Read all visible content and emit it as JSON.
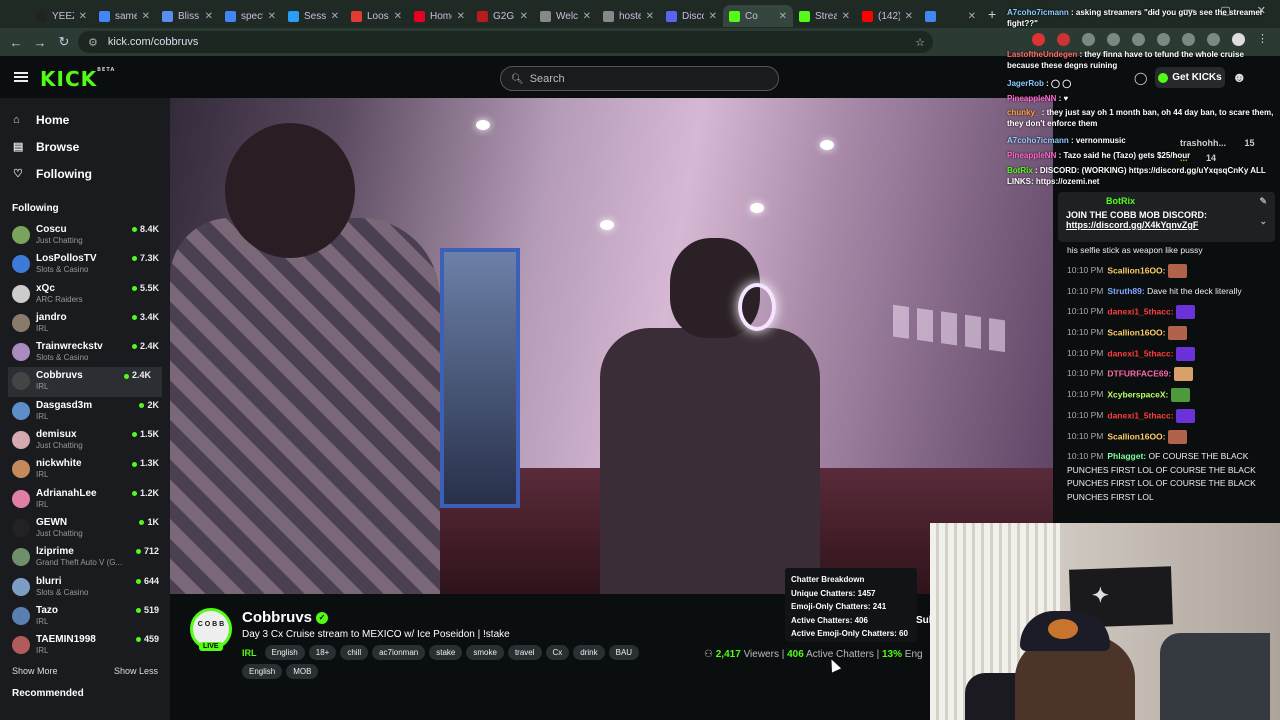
{
  "browser": {
    "tabs": [
      {
        "label": "YEEZY",
        "color": "#222222"
      },
      {
        "label": "same",
        "color": "#4285f4"
      },
      {
        "label": "Bliss",
        "color": "#5b8def"
      },
      {
        "label": "specti",
        "color": "#4285f4"
      },
      {
        "label": "Sessio",
        "color": "#2a9df4"
      },
      {
        "label": "Loose",
        "color": "#e03c31"
      },
      {
        "label": "Home",
        "color": "#e60023"
      },
      {
        "label": "G2G",
        "color": "#b71c1c"
      },
      {
        "label": "Welco",
        "color": "#888888"
      },
      {
        "label": "hostea",
        "color": "#888888"
      },
      {
        "label": "Disco",
        "color": "#5865f2"
      },
      {
        "label": "Co",
        "color": "#53fc18"
      },
      {
        "label": "Strean",
        "color": "#53fc18"
      },
      {
        "label": "(142)",
        "color": "#ff0000"
      },
      {
        "label": "",
        "color": "#4285f4"
      }
    ],
    "url": "kick.com/cobbruvs"
  },
  "header": {
    "logo": "KICK",
    "logo_badge": "BETA",
    "search_placeholder": "Search",
    "get_kicks": "Get KICKs"
  },
  "sidebar": {
    "nav": [
      {
        "label": "Home",
        "icon": "home-icon",
        "glyph": "⌂"
      },
      {
        "label": "Browse",
        "icon": "browse-icon",
        "glyph": "▤"
      },
      {
        "label": "Following",
        "icon": "heart-icon",
        "glyph": "♡"
      }
    ],
    "following_heading": "Following",
    "channels": [
      {
        "name": "Coscu",
        "category": "Just Chatting",
        "viewers": "8.4K",
        "color": "#7aa35b"
      },
      {
        "name": "LosPollosTV",
        "category": "Slots & Casino",
        "viewers": "7.3K",
        "color": "#3d7bd8"
      },
      {
        "name": "xQc",
        "category": "ARC Raiders",
        "viewers": "5.5K",
        "color": "#cccccc"
      },
      {
        "name": "jandro",
        "category": "IRL",
        "viewers": "3.4K",
        "color": "#8a7a6c"
      },
      {
        "name": "Trainwreckstv",
        "category": "Slots & Casino",
        "viewers": "2.4K",
        "color": "#a88cc0"
      },
      {
        "name": "Cobbruvs",
        "category": "IRL",
        "viewers": "2.4K",
        "color": "#444444"
      },
      {
        "name": "Dasgasd3m",
        "category": "IRL",
        "viewers": "2K",
        "color": "#5d8ec7"
      },
      {
        "name": "demisux",
        "category": "Just Chatting",
        "viewers": "1.5K",
        "color": "#d6a8b0"
      },
      {
        "name": "nickwhite",
        "category": "IRL",
        "viewers": "1.3K",
        "color": "#c48a5c"
      },
      {
        "name": "AdrianahLee",
        "category": "IRL",
        "viewers": "1.2K",
        "color": "#e07fa6"
      },
      {
        "name": "GEWN",
        "category": "Just Chatting",
        "viewers": "1K",
        "color": "#222222"
      },
      {
        "name": "lziprime",
        "category": "Grand Theft Auto V (G...",
        "viewers": "712",
        "color": "#6f8f6a"
      },
      {
        "name": "blurri",
        "category": "Slots & Casino",
        "viewers": "644",
        "color": "#7d9dc4"
      },
      {
        "name": "Tazo",
        "category": "IRL",
        "viewers": "519",
        "color": "#5a7fb0"
      },
      {
        "name": "TAEMIN1998",
        "category": "IRL",
        "viewers": "459",
        "color": "#b35a5a"
      }
    ],
    "show_more": "Show More",
    "show_less": "Show Less",
    "recommended": "Recommended"
  },
  "stream": {
    "avatar_text": "C O B B",
    "live": "LIVE",
    "name": "Cobbruvs",
    "verified_glyph": "✓",
    "title": "Day 3 Cx Cruise stream to MEXICO w/ Ice Poseidon | !stake",
    "category": "IRL",
    "tags": [
      "English",
      "18+",
      "chill",
      "ac7ionman",
      "stake",
      "smoke",
      "travel",
      "Cx",
      "drink",
      "BAU"
    ],
    "tags2": [
      "English",
      "MOB"
    ],
    "viewers": "2,417",
    "viewers_label": "Viewers",
    "active": "406",
    "active_label": "Active Chatters",
    "engaged": "13%",
    "engaged_label": "Eng",
    "sub_label": "Sub"
  },
  "tooltip": {
    "title": "Chatter Breakdown",
    "unique": "Unique Chatters: 1457",
    "emoji_only": "Emoji-Only Chatters: 241",
    "active": "Active Chatters: 406",
    "active_emoji": "Active Emoji-Only Chatters: 60"
  },
  "overlay_chat": [
    {
      "user": "A7coho7icmann",
      "text": " : asking streamers \"did you guys see the streamer fight??\"",
      "color": "#8ecbff"
    },
    {
      "user": "LastoftheUndegen",
      "text": " : they finna have to tefund the whole cruise because these degns ruining",
      "color": "#ff6b6b"
    },
    {
      "user": "JagerRob",
      "text": " : ◯ ◯",
      "color": "#8ecbff"
    },
    {
      "user": "PineappleNN",
      "text": " : ♥",
      "color": "#ff66cc"
    },
    {
      "user": "chunky_",
      "text": " : they just say oh 1 month ban, oh 44 day ban, to scare them, they don't enforce them",
      "color": "#ff9f40"
    },
    {
      "user": "A7coho7icmann",
      "text": " : vernonmusic",
      "color": "#8ecbff"
    },
    {
      "user": "PineappleNN",
      "text": " : Tazo said he (Tazo) gets $25/hour",
      "color": "#ff66cc"
    },
    {
      "user": "BotRix",
      "text": " : DISCORD: (WORKING) https://discord.gg/uYxqsqCnKy ALL LINKS: https://ozemi.net",
      "color": "#53fc18"
    }
  ],
  "overlay_side": [
    {
      "name": "trashohh...",
      "count": "15"
    },
    {
      "name": "...",
      "count": "14"
    }
  ],
  "pinned": {
    "author": "BotRix",
    "text": "JOIN THE COBB MOB DISCORD:",
    "link": "https://discord.gg/X4kYqnvZgF"
  },
  "chat": [
    {
      "time": "",
      "user": "",
      "text": "his selfie stick as weapon like pussy",
      "color": "#ffffff",
      "emote": ""
    },
    {
      "time": "10:10 PM",
      "user": "Scallion16OO:",
      "text": "",
      "color": "#ffcc66",
      "emote": "#b0634a"
    },
    {
      "time": "10:10 PM",
      "user": "Struth89:",
      "text": "Dave hit the deck literally",
      "color": "#7fa8ff",
      "emote": ""
    },
    {
      "time": "10:10 PM",
      "user": "danexi1_5thacc:",
      "text": "",
      "color": "#ff3b3b",
      "emote": "#6a32d8"
    },
    {
      "time": "10:10 PM",
      "user": "Scallion16OO:",
      "text": "",
      "color": "#ffcc66",
      "emote": "#b0634a"
    },
    {
      "time": "10:10 PM",
      "user": "danexi1_5thacc:",
      "text": "",
      "color": "#ff3b3b",
      "emote": "#6a32d8"
    },
    {
      "time": "10:10 PM",
      "user": "DTFURFACE69:",
      "text": "",
      "color": "#ff66aa",
      "emote": "#d9a06b"
    },
    {
      "time": "10:10 PM",
      "user": "XcyberspaceX:",
      "text": "",
      "color": "#b9ff66",
      "emote": "#4c9a3c"
    },
    {
      "time": "10:10 PM",
      "user": "danexi1_5thacc:",
      "text": "",
      "color": "#ff3b3b",
      "emote": "#6a32d8"
    },
    {
      "time": "10:10 PM",
      "user": "Scallion16OO:",
      "text": "",
      "color": "#ffcc66",
      "emote": "#b0634a"
    },
    {
      "time": "10:10 PM",
      "user": "Phlagget:",
      "text": "OF COURSE THE BLACK PUNCHES FIRST LOL OF COURSE THE BLACK PUNCHES FIRST LOL OF COURSE THE BLACK PUNCHES FIRST LOL",
      "color": "#7cff9a",
      "emote": ""
    }
  ],
  "colors": {
    "accent": "#53fc18",
    "bg": "#0b0e0f",
    "sidebar": "#191b1f"
  }
}
